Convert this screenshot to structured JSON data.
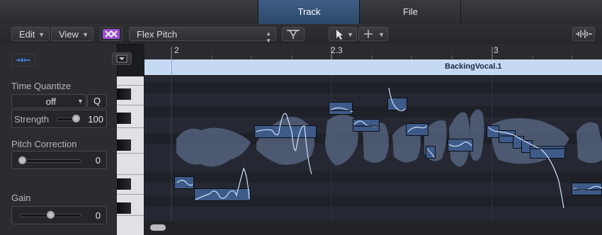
{
  "tabs": {
    "track": "Track",
    "file": "File"
  },
  "toolbar": {
    "edit_label": "Edit",
    "view_label": "View",
    "mode_label": "Flex Pitch",
    "accent_color": "#9a4fd0"
  },
  "inspector": {
    "time_quantize_title": "Time Quantize",
    "quantize_value": "off",
    "q_button": "Q",
    "strength_label": "Strength",
    "strength_value": "100",
    "pitch_correction_title": "Pitch Correction",
    "pitch_correction_value": "0",
    "gain_title": "Gain",
    "gain_value": "0"
  },
  "ruler": {
    "marks": [
      "2",
      "2.3",
      "3"
    ]
  },
  "region": {
    "name": "BackingVocal.1",
    "color": "#c6d9f3"
  },
  "colors": {
    "note_fill": "#3d5a88",
    "pitch_curve": "#cfe1ff",
    "waveform": "#5a6a86"
  }
}
